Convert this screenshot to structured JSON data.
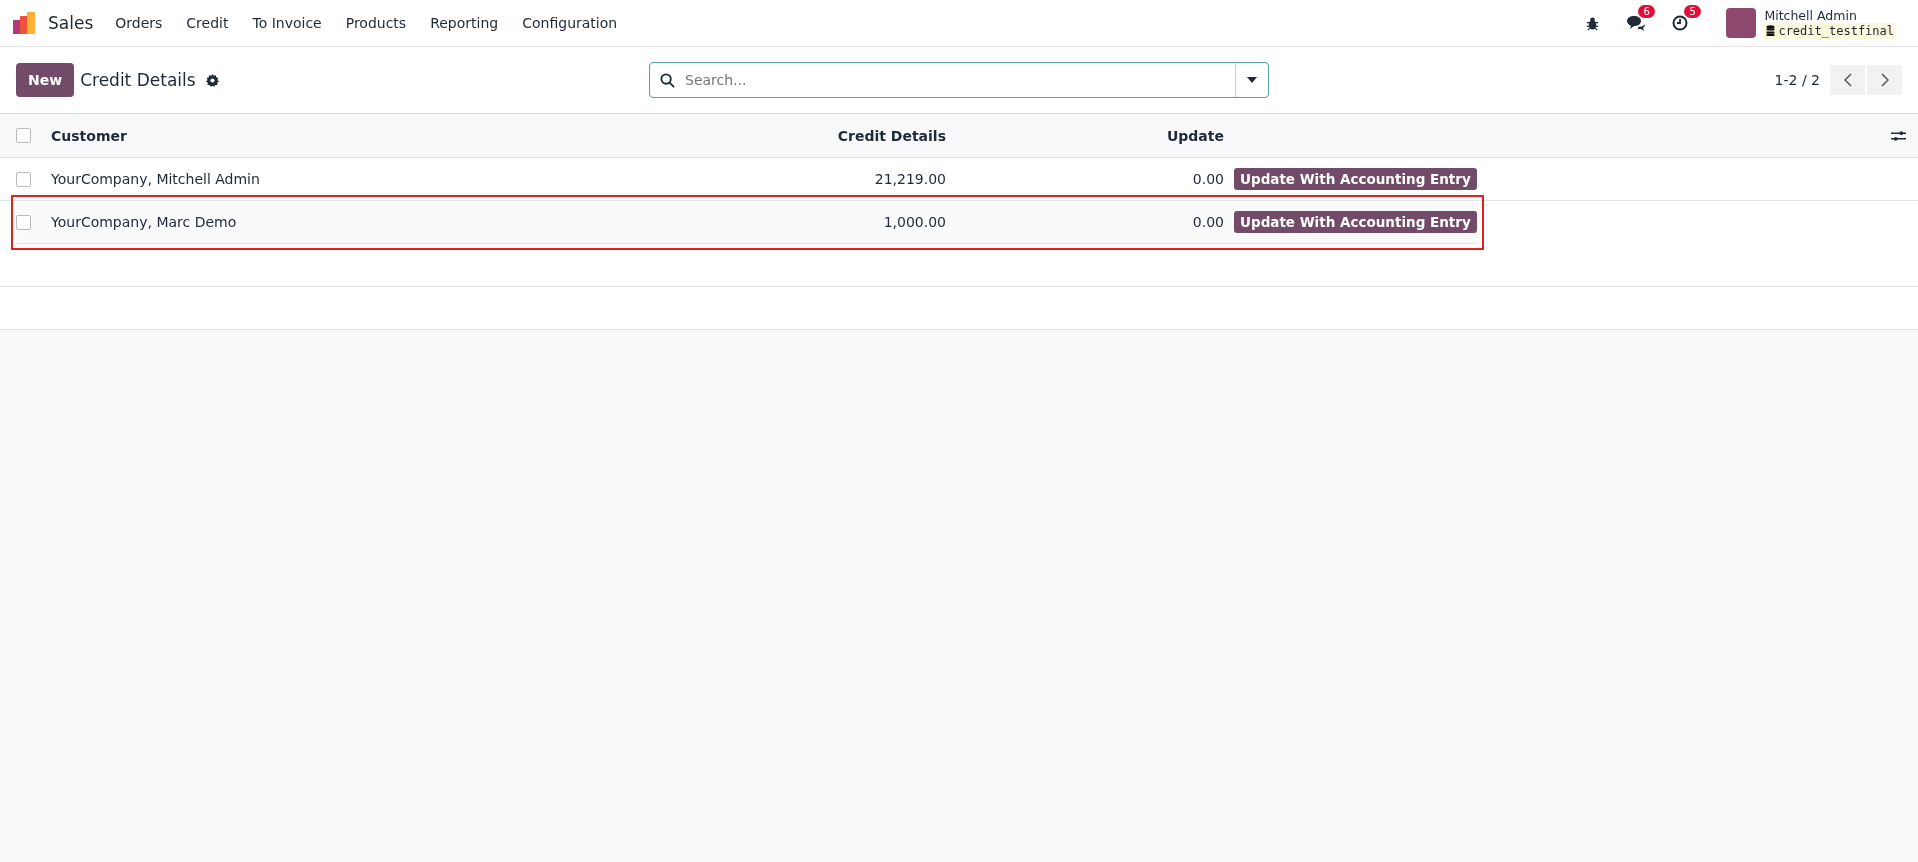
{
  "navbar": {
    "app_name": "Sales",
    "menu": [
      {
        "label": "Orders"
      },
      {
        "label": "Credit"
      },
      {
        "label": "To Invoice"
      },
      {
        "label": "Products"
      },
      {
        "label": "Reporting"
      },
      {
        "label": "Configuration"
      }
    ],
    "messages_count": "6",
    "activities_count": "5",
    "user_name": "Mitchell Admin",
    "database": "credit_testfinal"
  },
  "control_panel": {
    "new_button": "New",
    "title": "Credit Details",
    "search": {
      "placeholder": "Search..."
    },
    "pager": "1-2 / 2"
  },
  "table": {
    "select_all_checked": false,
    "columns": [
      {
        "label": "Customer"
      },
      {
        "label": "Credit Details"
      },
      {
        "label": "Update"
      }
    ],
    "rows": [
      {
        "customer": "YourCompany, Mitchell Admin",
        "credit_details": "21,219.00",
        "update": "0.00",
        "action": "Update With Accounting Entry",
        "checked": false,
        "highlighted": false
      },
      {
        "customer": "YourCompany, Marc Demo",
        "credit_details": "1,000.00",
        "update": "0.00",
        "action": "Update With Accounting Entry",
        "checked": false,
        "highlighted": true
      }
    ]
  }
}
